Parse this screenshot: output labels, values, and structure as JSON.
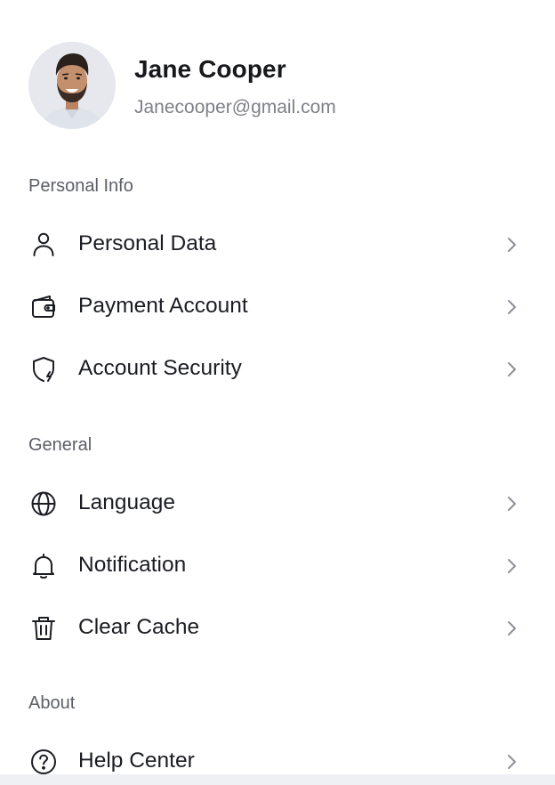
{
  "profile": {
    "name": "Jane Cooper",
    "email": "Janecooper@gmail.com"
  },
  "sections": {
    "personal_info": {
      "title": "Personal Info",
      "items": [
        {
          "label": "Personal Data",
          "icon": "user-icon"
        },
        {
          "label": "Payment Account",
          "icon": "wallet-icon"
        },
        {
          "label": "Account Security",
          "icon": "shield-icon"
        }
      ]
    },
    "general": {
      "title": "General",
      "items": [
        {
          "label": "Language",
          "icon": "globe-icon"
        },
        {
          "label": "Notification",
          "icon": "bell-icon"
        },
        {
          "label": "Clear Cache",
          "icon": "trash-icon"
        }
      ]
    },
    "about": {
      "title": "About",
      "items": [
        {
          "label": "Help Center",
          "icon": "help-circle-icon"
        }
      ]
    }
  },
  "colors": {
    "text_primary": "#1b1d22",
    "text_secondary": "#7d8087",
    "section_title": "#5c5f66",
    "chevron": "#8d9097",
    "background": "#ffffff"
  }
}
